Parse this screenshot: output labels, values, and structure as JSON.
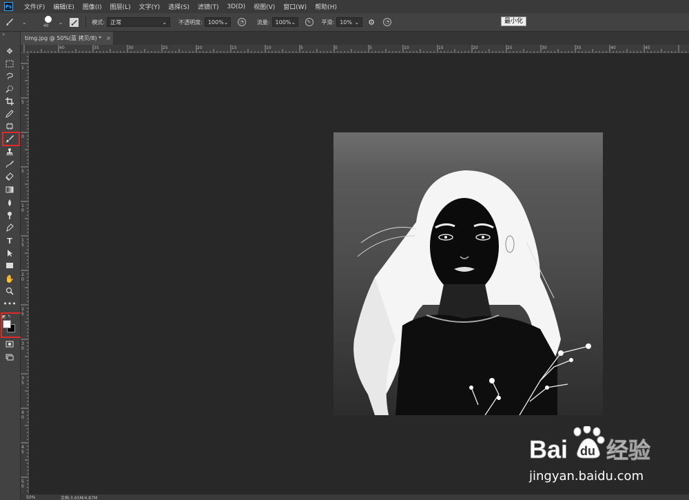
{
  "menu": {
    "logo_text": "Ps",
    "items": [
      "文件(F)",
      "编辑(E)",
      "图像(I)",
      "图层(L)",
      "文字(Y)",
      "选择(S)",
      "滤镜(T)",
      "3D(D)",
      "视图(V)",
      "窗口(W)",
      "帮助(H)"
    ]
  },
  "options": {
    "brush_size": "40",
    "mode_label": "模式:",
    "mode_value": "正常",
    "opacity_label": "不透明度:",
    "opacity_value": "100%",
    "flow_label": "流量:",
    "flow_value": "100%",
    "smooth_label": "平滑:",
    "smooth_value": "10%",
    "tooltip": "最小化"
  },
  "document": {
    "tab_title": "timg.jpg @ 50%(蓝 拷贝/8) *",
    "close_glyph": "×"
  },
  "status": {
    "zoom": "50%",
    "doc_info": "文档:3.65M/4.87M"
  },
  "rulers": {
    "horizontal": [
      "40",
      "35",
      "30",
      "25",
      "20",
      "15",
      "10",
      "5",
      "0",
      "5",
      "10",
      "15",
      "20",
      "25",
      "30",
      "35",
      "40",
      "45"
    ],
    "vertical": [
      "1",
      "5",
      "0",
      "5",
      "1",
      "0",
      "1",
      "5",
      "2",
      "0",
      "2",
      "5",
      "3",
      "0",
      "3",
      "5",
      "4",
      "0",
      "4",
      "5",
      "5",
      "0"
    ]
  },
  "tools": [
    "move-tool-icon",
    "marquee-tool-icon",
    "lasso-tool-icon",
    "quick-select-tool-icon",
    "crop-tool-icon",
    "eyedropper-tool-icon",
    "frame-tool-icon",
    "brush-tool-icon",
    "stamp-tool-icon",
    "history-brush-tool-icon",
    "eraser-tool-icon",
    "gradient-tool-icon",
    "blur-tool-icon",
    "dodge-tool-icon",
    "pen-tool-icon",
    "type-tool-icon",
    "path-select-tool-icon",
    "rectangle-tool-icon",
    "hand-tool-icon",
    "zoom-tool-icon",
    "more-tools-icon"
  ],
  "colors": {
    "foreground": "#ffffff",
    "background": "#000000",
    "highlight": "#e02a2a"
  },
  "watermark": {
    "brand_lead": "Bai",
    "brand_tail": "经验",
    "url": "jingyan.baidu.com"
  }
}
